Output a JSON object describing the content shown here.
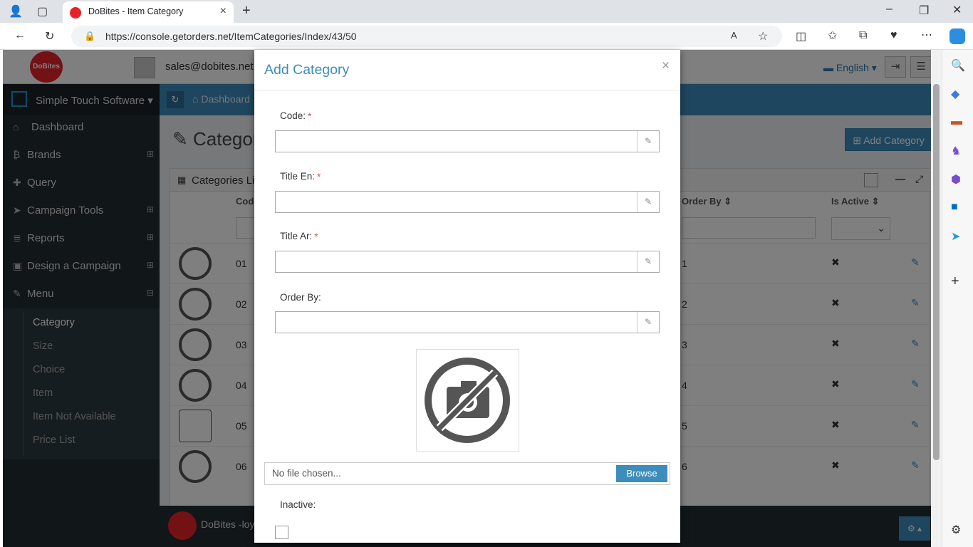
{
  "browser": {
    "tab_title": "DoBites - Item Category",
    "url": "https://console.getorders.net/ItemCategories/Index/43/50"
  },
  "header": {
    "logo_text": "DoBites",
    "user_email": "sales@dobites.net",
    "language": "English"
  },
  "sidebar": {
    "company": "Simple Touch Software",
    "items": [
      {
        "label": "Dashboard",
        "icon": "home-icon"
      },
      {
        "label": "Brands",
        "icon": "bitcoin-icon"
      },
      {
        "label": "Query",
        "icon": "puzzle-icon"
      },
      {
        "label": "Campaign Tools",
        "icon": "send-icon"
      },
      {
        "label": "Reports",
        "icon": "database-icon"
      },
      {
        "label": "Design a Campaign",
        "icon": "briefcase-icon"
      },
      {
        "label": "Menu",
        "icon": "edit-icon"
      }
    ],
    "submenu": [
      "Category",
      "Size",
      "Choice",
      "Item",
      "Item Not Available",
      "Price List"
    ]
  },
  "content": {
    "breadcrumb": "Dashboard",
    "page_title": "Categori",
    "add_button": "Add Category",
    "panel_title": "Categories Lis",
    "columns": {
      "code": "Code",
      "order_by": "Order By",
      "is_active": "Is Active"
    },
    "rows": [
      {
        "code": "01",
        "order": "1"
      },
      {
        "code": "02",
        "order": "2"
      },
      {
        "code": "03",
        "order": "3"
      },
      {
        "code": "04",
        "order": "4"
      },
      {
        "code": "05",
        "order": "5"
      },
      {
        "code": "06",
        "order": "6"
      }
    ],
    "footer_text": "DoBites -loya"
  },
  "modal": {
    "title": "Add Category",
    "close": "×",
    "fields": {
      "code": "Code:",
      "title_en": "Title En:",
      "title_ar": "Title Ar:",
      "order_by": "Order By:"
    },
    "required_mark": "*",
    "file_placeholder": "No file chosen...",
    "browse": "Browse",
    "inactive": "Inactive:"
  },
  "colors": {
    "accent": "#3c8dbc",
    "sidebar": "#222d32",
    "brand_red": "#e8222a"
  }
}
